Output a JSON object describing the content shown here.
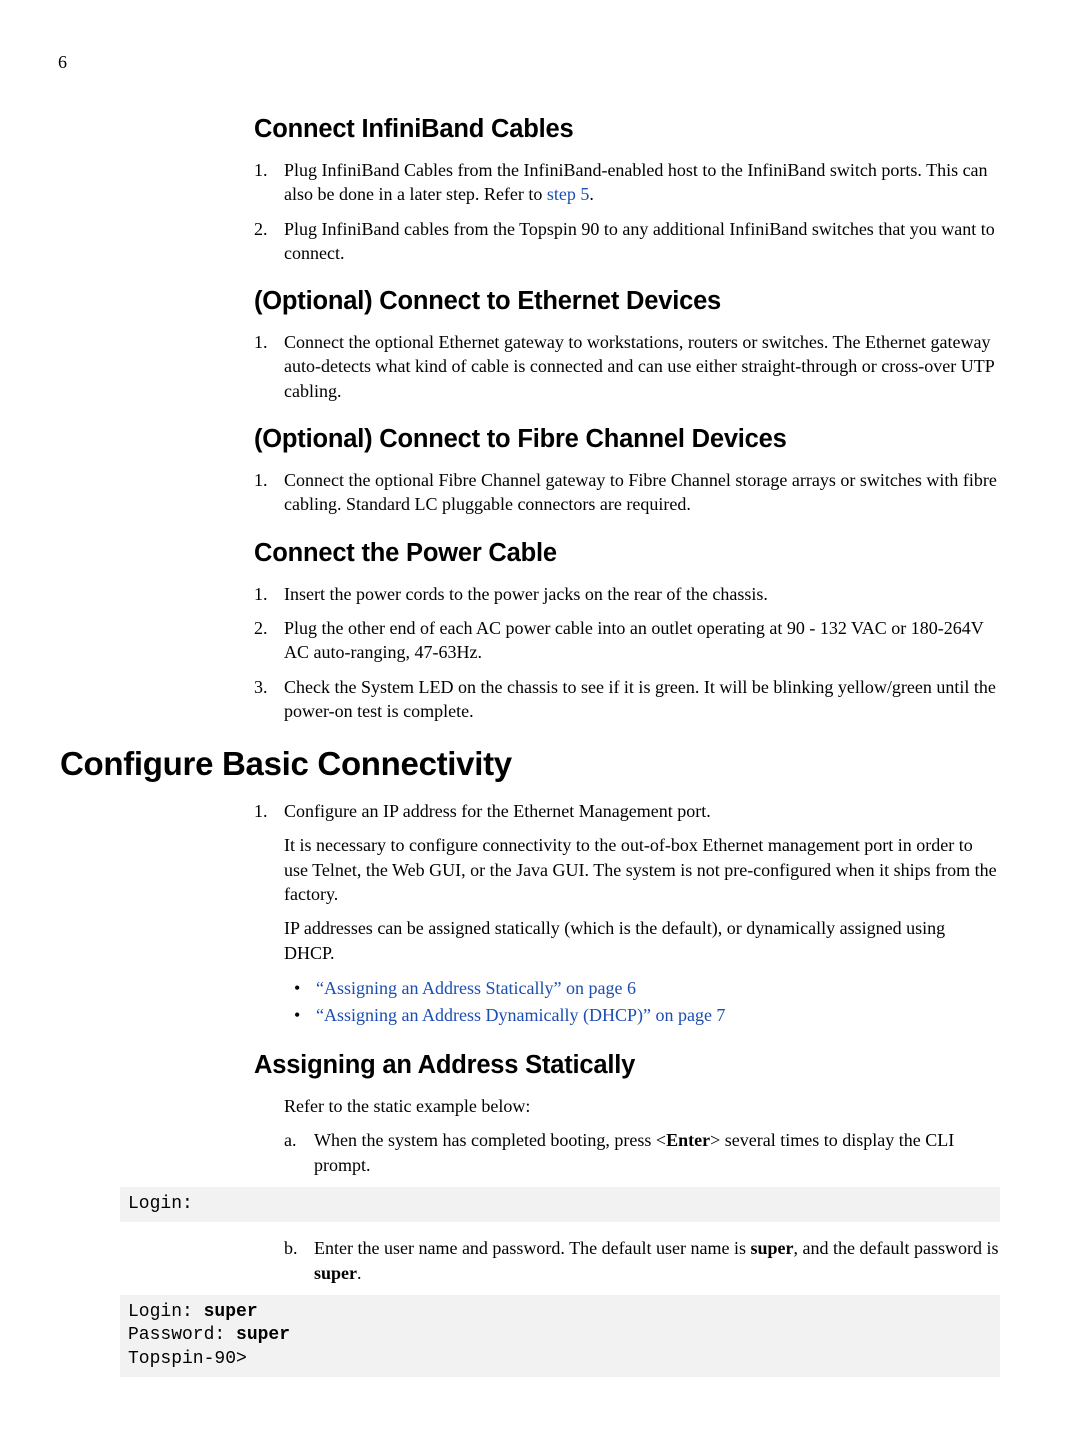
{
  "page_number": "6",
  "sections": {
    "s1": {
      "title": "Connect InfiniBand Cables",
      "item1_pre": "Plug InfiniBand Cables from the InfiniBand-enabled host to the InfiniBand switch ports. This can also be done in a later step. Refer to ",
      "item1_link": "step 5",
      "item1_post": ".",
      "item2": "Plug InfiniBand cables from the Topspin 90 to any additional InfiniBand switches that you want to connect."
    },
    "s2": {
      "title": "(Optional) Connect to Ethernet Devices",
      "item1": "Connect the optional Ethernet gateway to workstations, routers or switches. The Ethernet gateway auto-detects what kind of cable is connected and can use either straight-through or cross-over UTP cabling."
    },
    "s3": {
      "title": "(Optional) Connect to Fibre Channel Devices",
      "item1": "Connect the optional Fibre Channel gateway to Fibre Channel storage arrays or switches with fibre cabling. Standard LC pluggable connectors are required."
    },
    "s4": {
      "title": "Connect the Power Cable",
      "item1": "Insert the power cords to the power jacks on the rear of the chassis.",
      "item2": "Plug the other end of each AC power cable into an outlet operating at 90 - 132 VAC or 180-264V AC auto-ranging, 47-63Hz.",
      "item3": "Check the System LED on the chassis to see if it is green. It will be blinking yellow/green until the power-on test is complete."
    },
    "h1": "Configure Basic Connectivity",
    "s5": {
      "item1": "Configure an IP address for the Ethernet Management port.",
      "p1": "It is necessary to configure connectivity to the out-of-box Ethernet management port in order to use Telnet, the Web GUI, or the Java GUI. The system is not pre-configured when it ships from the factory.",
      "p2": "IP addresses can be assigned statically (which is the default), or dynamically assigned using DHCP.",
      "link1": "“Assigning an Address Statically” on page 6",
      "link2": "“Assigning an Address Dynamically (DHCP)” on page 7"
    },
    "s6": {
      "title": "Assigning an Address Statically",
      "intro": "Refer to the static example below:",
      "a_pre": "When the system has completed booting, press <",
      "a_bold": "Enter",
      "a_post": "> several times to display the CLI prompt.",
      "b_pre": "Enter the user name and password. The default user name is ",
      "b_bold1": "super",
      "b_mid": ", and the default password is ",
      "b_bold2": "super",
      "b_post": "."
    }
  },
  "code1_line1": "Login:",
  "code2_line1_label": "Login: ",
  "code2_line1_val": "super",
  "code2_line2_label": "Password: ",
  "code2_line2_val": "super",
  "code2_line3": "Topspin-90>"
}
